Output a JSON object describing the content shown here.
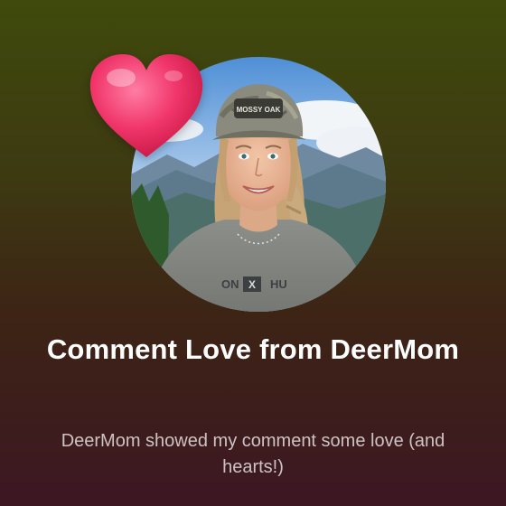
{
  "notification": {
    "title": "Comment Love from DeerMom",
    "description": "DeerMom showed my comment some love (and hearts!)"
  },
  "avatar": {
    "cap_text": "MOSSY OAK",
    "shirt_text_left": "ON",
    "shirt_text_mark": "X",
    "shirt_text_right": "HU"
  },
  "colors": {
    "heart": "#f0356a",
    "sky": "#7fb4e8",
    "mountains": "#5c7d96",
    "shirt": "#8a8c88",
    "title_text": "#ffffff",
    "subtitle_text": "#cdc3c3"
  },
  "icons": {
    "reaction": "heart-icon"
  }
}
